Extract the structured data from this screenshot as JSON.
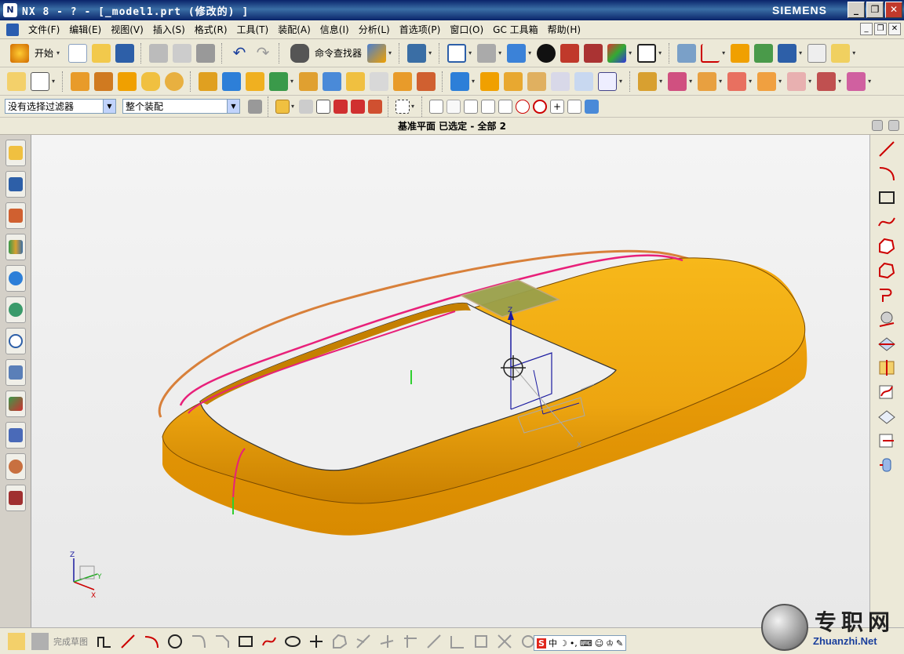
{
  "window": {
    "title": "NX 8 - ? - [_model1.prt  (修改的) ]",
    "brand": "SIEMENS",
    "controls": [
      "_",
      "❐",
      "✕"
    ]
  },
  "menubar": {
    "items": [
      "文件(F)",
      "编辑(E)",
      "视图(V)",
      "插入(S)",
      "格式(R)",
      "工具(T)",
      "装配(A)",
      "信息(I)",
      "分析(L)",
      "首选项(P)",
      "窗口(O)",
      "GC 工具箱",
      "帮助(H)"
    ]
  },
  "toolbar": {
    "start_label": "开始",
    "command_finder_label": "命令查找器"
  },
  "selection_bar": {
    "filter_value": "没有选择过滤器",
    "scope_value": "整个装配"
  },
  "status": {
    "cue_line": "基准平面 已选定 - 全部 2"
  },
  "sketch_toolbar": {
    "finish_label": "完成草图"
  },
  "ime": {
    "logo": "S",
    "mode": "中"
  },
  "watermark": {
    "chinese": "专职网",
    "url": "Zhuanzhi.Net"
  },
  "triad": {
    "z_label": "Z",
    "x_label": "X",
    "y_label": "Y"
  },
  "csys_small": {
    "z_label": "Z",
    "y_label": "Y",
    "x_label": "X"
  },
  "colors": {
    "title_bar": "#0a246a",
    "part_body": "#f0a800",
    "highlight_curve": "#e8207a",
    "orange_curve": "#d8803a",
    "datum_plane": "#9aa04a"
  }
}
